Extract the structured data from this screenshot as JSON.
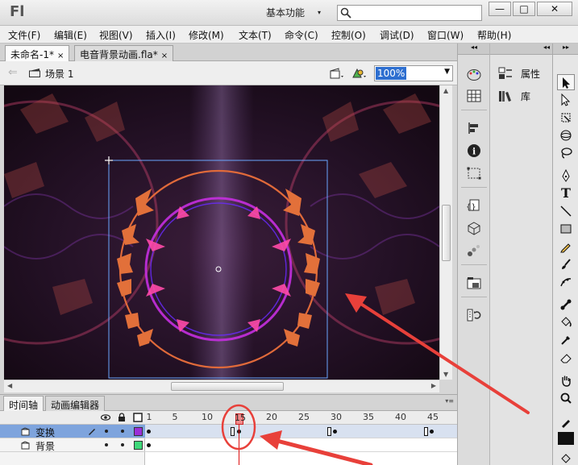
{
  "titlebar": {
    "app_logo": "Fl",
    "workspace_label": "基本功能",
    "search_placeholder": "",
    "minimize": "—",
    "maximize": "□",
    "close": "✕"
  },
  "menubar": {
    "items": [
      "文件(F)",
      "编辑(E)",
      "视图(V)",
      "插入(I)",
      "修改(M)",
      "文本(T)",
      "命令(C)",
      "控制(O)",
      "调试(D)",
      "窗口(W)",
      "帮助(H)"
    ]
  },
  "tabs": [
    {
      "label": "未命名-1*",
      "close": "×",
      "active": true
    },
    {
      "label": "电音背景动画.fla*",
      "close": "×",
      "active": false
    }
  ],
  "editbar": {
    "back_arrow": "⇐",
    "scene_label": "场景 1",
    "zoom": "100%"
  },
  "timeline": {
    "tabs": [
      "时间轴",
      "动画编辑器"
    ],
    "ruler": [
      "1",
      "5",
      "10",
      "15",
      "20",
      "25",
      "30",
      "35",
      "40",
      "45"
    ],
    "current_frame": "15",
    "layers": [
      {
        "name": "变换",
        "selected": true,
        "color": "#9b2fd8"
      },
      {
        "name": "背景",
        "selected": false,
        "color": "#3fd87a"
      }
    ]
  },
  "properties_panel": {
    "items": [
      {
        "label": "属性",
        "icon": "properties-icon"
      },
      {
        "label": "库",
        "icon": "library-icon"
      }
    ]
  },
  "colors": {
    "stage_bg": "#160a18",
    "selection_blue": "#7ea4dd",
    "annotation_red": "#e8403a",
    "playhead_red": "#d11111"
  }
}
